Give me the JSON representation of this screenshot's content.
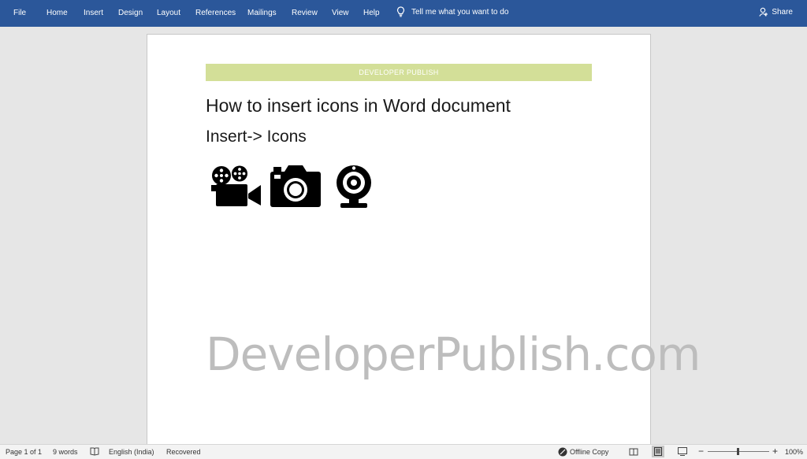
{
  "ribbon": {
    "tabs": [
      "File",
      "Home",
      "Insert",
      "Design",
      "Layout",
      "References",
      "Mailings",
      "Review",
      "View",
      "Help"
    ],
    "tell_me": "Tell me what you want to do",
    "share": "Share"
  },
  "document": {
    "header_band": "DEVELOPER PUBLISH",
    "title": "How to insert icons in Word document",
    "subtitle": "Insert-> Icons",
    "icons": [
      "movie-camera-icon",
      "camera-icon",
      "webcam-icon"
    ],
    "watermark": "DeveloperPublish.com"
  },
  "status_bar": {
    "page": "Page 1 of 1",
    "words": "9 words",
    "language": "English (India)",
    "recovered": "Recovered",
    "offline": "Offline Copy",
    "zoom": "100%",
    "zoom_minus": "−",
    "zoom_plus": "+"
  },
  "colors": {
    "ribbon": "#2b579a",
    "header_band": "#d3df98",
    "watermark": "#bdbdbd"
  }
}
